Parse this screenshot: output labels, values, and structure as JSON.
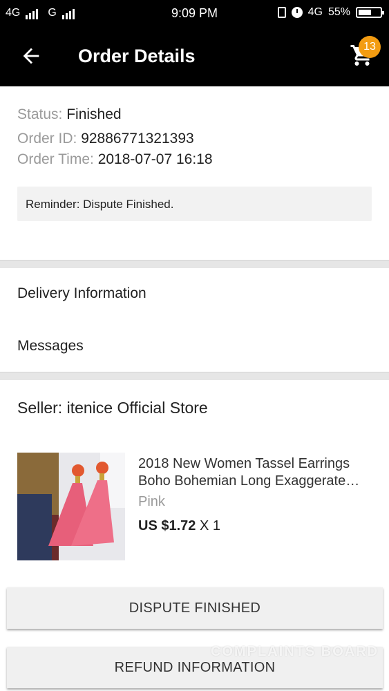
{
  "status_bar": {
    "network1": "4G",
    "network2": "G",
    "time": "9:09 PM",
    "network3": "4G",
    "battery": "55%"
  },
  "app_bar": {
    "title": "Order Details",
    "cart_count": "13"
  },
  "order": {
    "status_label": "Status: ",
    "status_value": "Finished",
    "id_label": "Order ID: ",
    "id_value": "92886771321393",
    "time_label": "Order Time: ",
    "time_value": "2018-07-07 16:18",
    "reminder": "Reminder: Dispute Finished."
  },
  "menu": {
    "delivery": "Delivery Information",
    "messages": "Messages"
  },
  "seller": "Seller: itenice Official Store",
  "product": {
    "title_line1": "2018 New Women Tassel Earrings",
    "title_line2": "Boho Bohemian Long Exaggerate…",
    "variant": "Pink",
    "price": "US $1.72",
    "quantity": "X 1"
  },
  "buttons": {
    "dispute": "DISPUTE FINISHED",
    "refund": "REFUND INFORMATION"
  },
  "watermark": "COMPLAINTS BOARD"
}
